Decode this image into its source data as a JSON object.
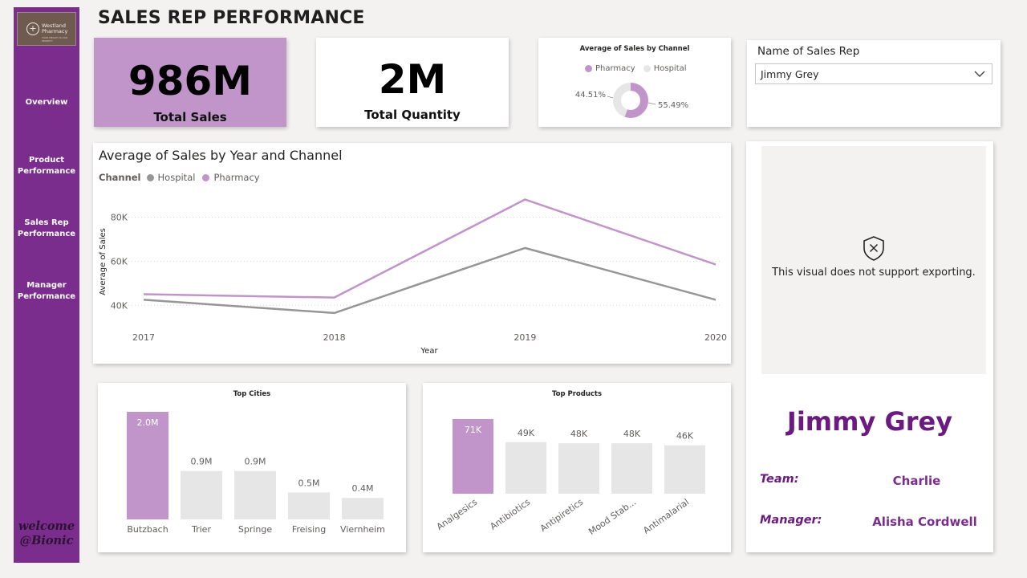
{
  "sidebar": {
    "logo": {
      "line1": "Westland",
      "line2": "Pharmacy",
      "tagline": "YOUR HEALTH IS OUR PRIORITY"
    },
    "items": [
      {
        "label_lines": [
          "Overview"
        ]
      },
      {
        "label_lines": [
          "Product",
          "Performance"
        ]
      },
      {
        "label_lines": [
          "Sales Rep",
          "Performance"
        ]
      },
      {
        "label_lines": [
          "Manager",
          "Performance"
        ]
      }
    ],
    "welcome_line1": "welcome",
    "welcome_line2": "@Bionic"
  },
  "page_title": "SALES REP PERFORMANCE",
  "kpis": {
    "total_sales": {
      "value": "986M",
      "label": "Total Sales"
    },
    "total_quantity": {
      "value": "2M",
      "label": "Total Quantity"
    }
  },
  "slicer": {
    "title": "Name of Sales Rep",
    "selected": "Jimmy Grey"
  },
  "export_notice": "This visual does not support exporting.",
  "rep_card": {
    "name": "Jimmy Grey",
    "team_label": "Team:",
    "team_value": "Charlie",
    "manager_label": "Manager:",
    "manager_value": "Alisha Cordwell"
  },
  "colors": {
    "sidebar": "#7b2d8e",
    "pharmacy": "#c195c9",
    "hospital": "#969696",
    "hospital_donut": "#e6e6e6",
    "bar_other": "#e6e6e6",
    "accent_text": "#6b1a7f"
  },
  "chart_data": [
    {
      "id": "donut",
      "type": "pie",
      "title": "Average of Sales by Channel",
      "legend": [
        "Pharmacy",
        "Hospital"
      ],
      "slices": [
        {
          "name": "Pharmacy",
          "value": 55.49,
          "label": "55.49%"
        },
        {
          "name": "Hospital",
          "value": 44.51,
          "label": "44.51%"
        }
      ]
    },
    {
      "id": "line",
      "type": "line",
      "title": "Average of Sales by Year and Channel",
      "legend_title": "Channel",
      "legend": [
        "Hospital",
        "Pharmacy"
      ],
      "xlabel": "Year",
      "ylabel": "Average of Sales",
      "x": [
        "2017",
        "2018",
        "2019",
        "2020"
      ],
      "ylim": [
        35000,
        90000
      ],
      "yticks": [
        40000,
        60000,
        80000
      ],
      "ytick_labels": [
        "40K",
        "60K",
        "80K"
      ],
      "grid": true,
      "series": [
        {
          "name": "Pharmacy",
          "values": [
            45000,
            43500,
            88000,
            58500
          ]
        },
        {
          "name": "Hospital",
          "values": [
            42500,
            36500,
            66000,
            42500
          ]
        }
      ]
    },
    {
      "id": "cities",
      "type": "bar",
      "title": "Top Cities",
      "categories": [
        "Butzbach",
        "Trier",
        "Springe",
        "Freising",
        "Viernheim"
      ],
      "values": [
        2.0,
        0.9,
        0.9,
        0.5,
        0.4
      ],
      "value_labels": [
        "2.0M",
        "0.9M",
        "0.9M",
        "0.5M",
        "0.4M"
      ],
      "unit": "M",
      "ylim": [
        0,
        2.0
      ]
    },
    {
      "id": "products",
      "type": "bar",
      "title": "Top Products",
      "categories": [
        "Analgesics",
        "Antibiotics",
        "Antipiretics",
        "Mood Stab...",
        "Antimalarial"
      ],
      "values": [
        71,
        49,
        48,
        48,
        46
      ],
      "value_labels": [
        "71K",
        "49K",
        "48K",
        "48K",
        "46K"
      ],
      "unit": "K",
      "ylim": [
        0,
        71
      ]
    }
  ]
}
